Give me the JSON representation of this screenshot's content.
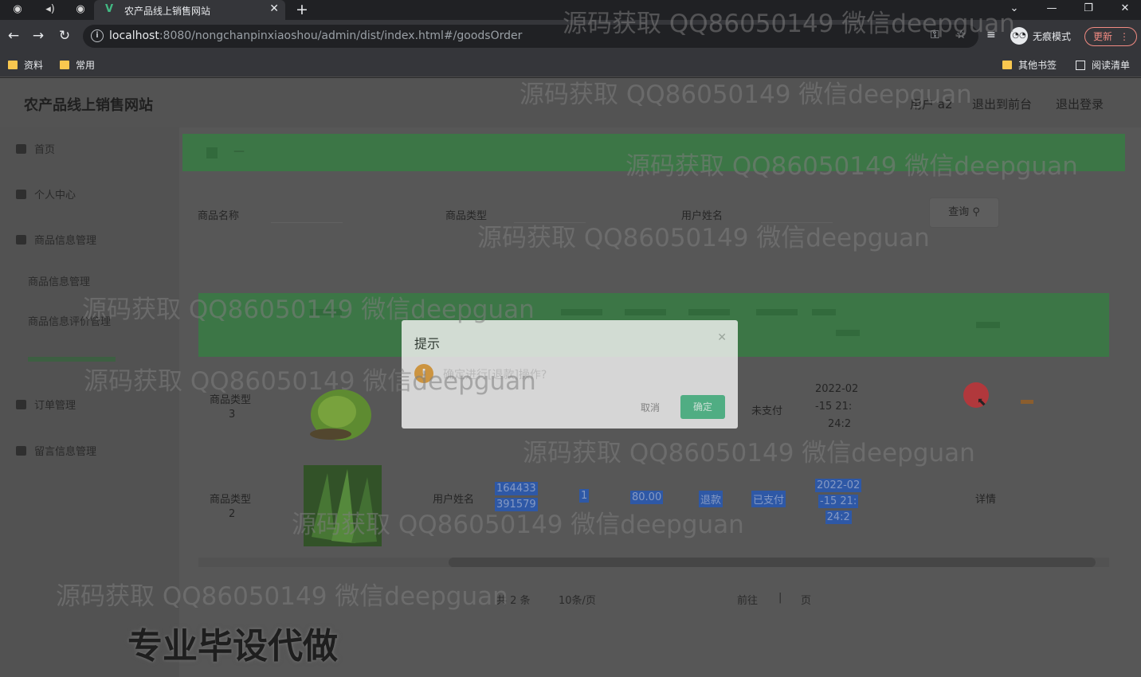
{
  "browser": {
    "tab_title": "农产品线上销售网站",
    "tab_favicon": "V",
    "url_host": "localhost",
    "url_rest": ":8080/nongchanpinxiaoshou/admin/dist/index.html#/goodsOrder",
    "incognito_label": "无痕模式",
    "update_label": "更新",
    "bookmarks": [
      "资料",
      "常用"
    ],
    "bookmarks_right": [
      "其他书签",
      "阅读清单"
    ]
  },
  "header": {
    "site_title": "农产品线上销售网站",
    "user": "用户 a2",
    "back_to_front": "退出到前台",
    "logout": "退出登录"
  },
  "sidebar": {
    "items": [
      {
        "label": "首页",
        "icon": "home-icon"
      },
      {
        "label": "个人中心",
        "icon": "user-icon"
      },
      {
        "label": "商品信息管理",
        "icon": "menu-icon"
      },
      {
        "label": "订单管理",
        "icon": "order-icon"
      },
      {
        "label": "留言信息管理",
        "icon": "message-icon"
      }
    ],
    "subitems": [
      "商品信息管理",
      "商品信息评价管理"
    ]
  },
  "search": {
    "goods_name_label": "商品名称",
    "goods_type_label": "商品类型",
    "user_name_label": "用户姓名",
    "query_label": "查询"
  },
  "rows": [
    {
      "type_label": "商品类型",
      "type_value": "3",
      "status": "未支付",
      "date_line1": "2022-02",
      "date_line2": "-15 21:",
      "date_line3": "24:2"
    },
    {
      "type_label": "商品类型",
      "type_value": "2",
      "user_label": "用户姓名",
      "code": "164433",
      "code2": "391579",
      "num": "1",
      "price": "80.00",
      "action": "退款",
      "status": "已支付",
      "date_line1": "2022-02",
      "date_line2": "-15 21:",
      "date_line3": "24:2",
      "detail": "详情"
    }
  ],
  "pagination": {
    "total": "共 2 条",
    "page_size": "10条/页",
    "goto": "前往",
    "page_unit": "页"
  },
  "dialog": {
    "title": "提示",
    "message": "确定进行[退款]操作?",
    "cancel": "取消",
    "confirm": "确定"
  },
  "watermark": "源码获取 QQ86050149 微信deepguan",
  "ad_text": "专业毕设代做",
  "colors": {
    "primary": "#3c8a4a",
    "confirm": "#4fc08d",
    "warning": "#e6a23c",
    "highlight": "#2a62c9"
  }
}
